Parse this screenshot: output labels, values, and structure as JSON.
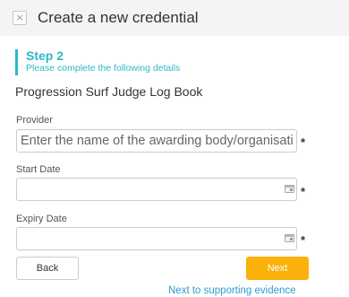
{
  "header": {
    "close_glyph": "×",
    "title": "Create a new credential"
  },
  "step": {
    "label": "Step 2",
    "subtitle": "Please complete the following details"
  },
  "credential_name": "Progression Surf Judge Log Book",
  "fields": {
    "provider": {
      "label": "Provider",
      "value": "",
      "placeholder": "Enter the name of the awarding body/organisation",
      "required_marker": "*"
    },
    "start_date": {
      "label": "Start Date",
      "value": "",
      "icon": "calendar-icon",
      "required_marker": "*"
    },
    "expiry_date": {
      "label": "Expiry Date",
      "value": "",
      "icon": "calendar-icon",
      "required_marker": "*"
    }
  },
  "buttons": {
    "back": "Back",
    "next": "Next"
  },
  "links": {
    "next_to_evidence": "Next to supporting evidence"
  },
  "colors": {
    "accent": "#2eb8c4",
    "next_button": "#fab10a",
    "link": "#2b9cd0",
    "header_bg": "#f4f4f4"
  }
}
